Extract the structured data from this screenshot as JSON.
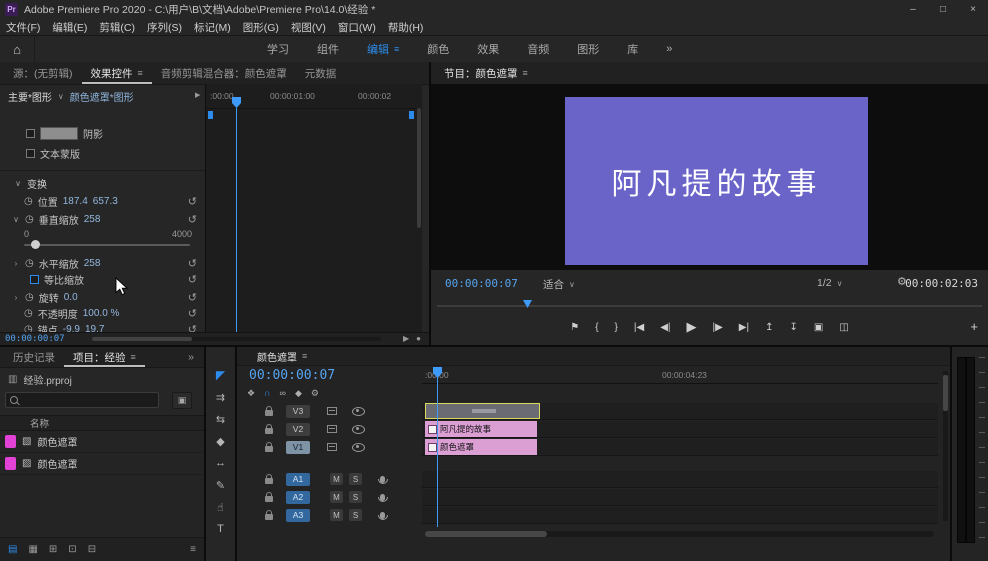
{
  "titlebar": {
    "logo": "Pr",
    "title": "Adobe Premiere Pro 2020 - C:\\用户\\B\\文档\\Adobe\\Premiere Pro\\14.0\\经验 *",
    "minimize": "–",
    "maximize": "□",
    "close": "×"
  },
  "menubar": {
    "items": [
      "文件(F)",
      "编辑(E)",
      "剪辑(C)",
      "序列(S)",
      "标记(M)",
      "图形(G)",
      "视图(V)",
      "窗口(W)",
      "帮助(H)"
    ]
  },
  "workspace": {
    "home": "⌂",
    "tabs": [
      "学习",
      "组件",
      "编辑",
      "颜色",
      "效果",
      "音频",
      "图形",
      "库"
    ],
    "overflow": "»"
  },
  "icons": {
    "menu": "≡",
    "caret_down": "∨",
    "chevron_collapsed": "›",
    "chevron_expanded": "∨",
    "stopwatch": "◷",
    "reset": "↺",
    "expand": "▶",
    "play_mini": "▶",
    "loop_mini": "●",
    "wrench": "⚙",
    "search_btn": "▣",
    "file": "▥",
    "matte1": "▧",
    "matte2": "▨",
    "footer_more": "≡"
  },
  "effect_controls": {
    "tab_source": "源：(无剪辑)",
    "tab_effects": "效果控件",
    "tab_mixer": "音频剪辑混合器：颜色遮罩",
    "tab_metadata": "元数据",
    "master_label": "主要*图形",
    "clip_label": "颜色遮罩*图形",
    "ruler_ticks": [
      ":00:00",
      "00:00:01:00",
      "00:00:02"
    ],
    "shadow_label": "阴影",
    "text_mask_label": "文本蒙版",
    "transform_label": "变换",
    "position_label": "位置",
    "position_x": "187.4",
    "position_y": "657.3",
    "vertical_scale_label": "垂直缩放",
    "vertical_scale_value": "258",
    "slider_min": "0",
    "slider_max": "4000",
    "horizontal_scale_label": "水平缩放",
    "horizontal_scale_value": "258",
    "uniform_scale_label": "等比缩放",
    "rotation_label": "旋转",
    "rotation_value": "0.0",
    "opacity_label": "不透明度",
    "opacity_value": "100.0 %",
    "anchor_label": "锚点",
    "anchor_x": "-9.9",
    "anchor_y": "19.7",
    "timecode": "00:00:00:07"
  },
  "program": {
    "tab": "节目：颜色遮罩",
    "overlay_text": "阿凡提的故事",
    "matte_color": "#6a63c8",
    "timecode": "00:00:00:07",
    "zoom_level": "适合",
    "playback_resolution": "1/2",
    "duration": "00:00:02:03",
    "transport": [
      {
        "name": "add-marker",
        "glyph": "⚑"
      },
      {
        "name": "mark-in",
        "glyph": "{"
      },
      {
        "name": "mark-out",
        "glyph": "}"
      },
      {
        "name": "go-to-in",
        "glyph": "|◀"
      },
      {
        "name": "step-back",
        "glyph": "◀|"
      },
      {
        "name": "play",
        "glyph": "▶"
      },
      {
        "name": "step-forward",
        "glyph": "|▶"
      },
      {
        "name": "go-to-out",
        "glyph": "▶|"
      },
      {
        "name": "lift",
        "glyph": "↥"
      },
      {
        "name": "extract",
        "glyph": "↧"
      },
      {
        "name": "export-frame",
        "glyph": "▣"
      },
      {
        "name": "comparison-view",
        "glyph": "◫"
      }
    ],
    "add_button": "+"
  },
  "project": {
    "tab_history": "历史记录",
    "tab_project": "项目：经验",
    "overflow": "»",
    "file_name": "经验.prproj",
    "search_value": "",
    "name_column": "名称",
    "items": [
      {
        "label": "颜色遮罩",
        "chip_color": "#e243d6"
      },
      {
        "label": "颜色遮罩",
        "chip_color": "#e243d6"
      }
    ],
    "footer": [
      {
        "name": "list-view",
        "glyph": "▤"
      },
      {
        "name": "icon-view",
        "glyph": "▦"
      },
      {
        "name": "new-bin",
        "glyph": "⊞"
      },
      {
        "name": "new-item",
        "glyph": "⊡"
      },
      {
        "name": "delete",
        "glyph": "⊟"
      }
    ]
  },
  "tools": [
    {
      "name": "selection-tool",
      "glyph": "◤"
    },
    {
      "name": "track-select-forward-tool",
      "glyph": "⇉"
    },
    {
      "name": "ripple-edit-tool",
      "glyph": "⇆"
    },
    {
      "name": "razor-tool",
      "glyph": "◆"
    },
    {
      "name": "slip-tool",
      "glyph": "↔"
    },
    {
      "name": "pen-tool",
      "glyph": "✎"
    },
    {
      "name": "hand-tool",
      "glyph": "☝"
    },
    {
      "name": "type-tool",
      "glyph": "T"
    }
  ],
  "timeline": {
    "tab": "颜色遮罩",
    "timecode": "00:00:00:07",
    "ruler_start": ":00:00",
    "ruler_label": "00:00:04:23",
    "toolbar": [
      {
        "name": "nest-toggle",
        "glyph": "❖"
      },
      {
        "name": "snap",
        "glyph": "∩"
      },
      {
        "name": "linked-selection",
        "glyph": "∞"
      },
      {
        "name": "add-marker",
        "glyph": "◆"
      },
      {
        "name": "timeline-settings",
        "glyph": "⚙"
      }
    ],
    "video_tracks": [
      "V3",
      "V2",
      "V1"
    ],
    "audio_tracks": [
      "A1",
      "A2",
      "A3"
    ],
    "mute_label": "M",
    "solo_label": "S",
    "clip_v2_label": "阿凡提的故事",
    "clip_v1_label": "颜色遮罩"
  },
  "colors": {
    "accent_blue": "#2d8ceb",
    "timecode_blue": "#55a3f0",
    "value_blue": "#93b7df",
    "clip_pink": "#dc9fd4",
    "selected_clip_border": "#d9d95c",
    "matte_purple": "#6a63c8"
  }
}
